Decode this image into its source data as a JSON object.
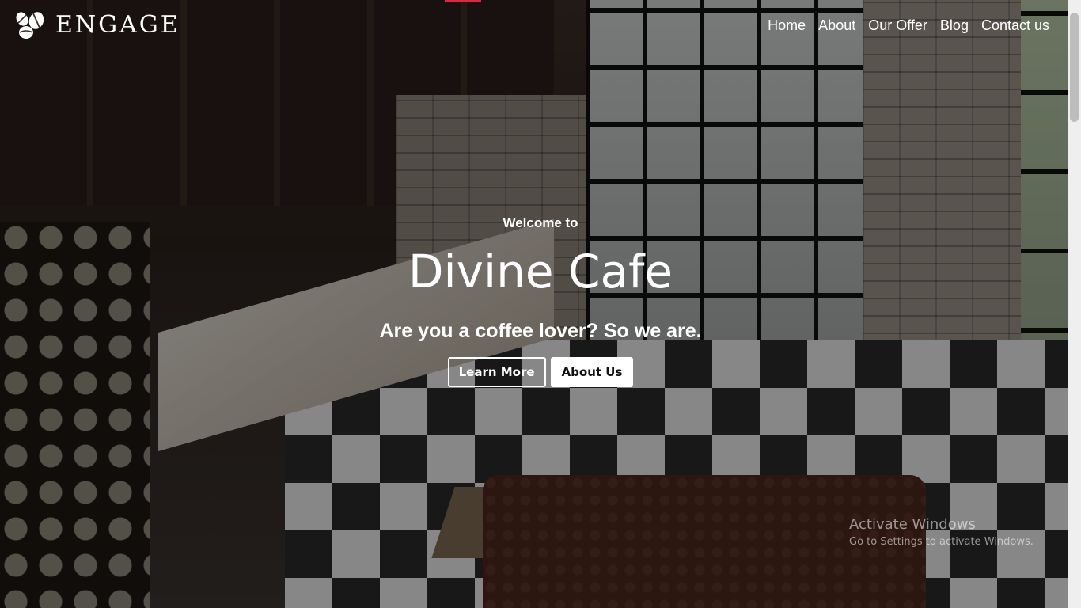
{
  "brand": {
    "name": "ENGAGE",
    "logo_icon": "coffee-beans-icon"
  },
  "nav": {
    "items": [
      {
        "label": "Home"
      },
      {
        "label": "About"
      },
      {
        "label": "Our Offer"
      },
      {
        "label": "Blog"
      },
      {
        "label": "Contact us"
      }
    ]
  },
  "hero": {
    "welcome": "Welcome to",
    "title": "Divine Cafe",
    "tagline": "Are you a coffee lover? So we are.",
    "learn_more_label": "Learn More",
    "about_us_label": "About Us"
  },
  "watermark": {
    "title": "Activate Windows",
    "subtitle": "Go to Settings to activate Windows."
  },
  "colors": {
    "accent": "#e0263a",
    "text": "#ffffff"
  }
}
